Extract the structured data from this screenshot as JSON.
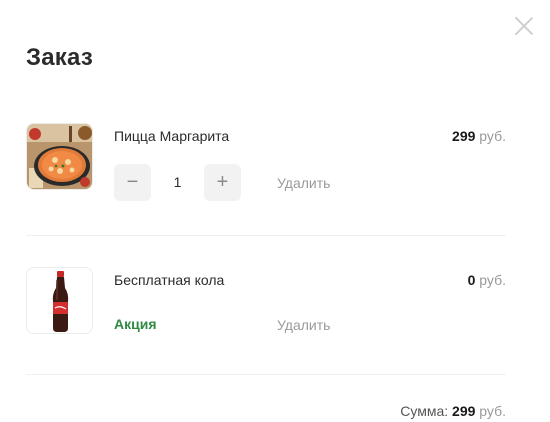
{
  "modal": {
    "title": "Заказ",
    "close_icon": "close-icon"
  },
  "items": [
    {
      "name": "Пицца Маргарита",
      "price_value": "299",
      "price_unit": "руб.",
      "quantity": "1",
      "minus_label": "−",
      "plus_label": "+",
      "delete_label": "Удалить",
      "image": "pizza-image"
    },
    {
      "name": "Бесплатная кола",
      "price_value": "0",
      "price_unit": "руб.",
      "promo_label": "Акция",
      "delete_label": "Удалить",
      "image": "cola-bottle-image"
    }
  ],
  "summary": {
    "label": "Сумма:",
    "value": "299",
    "unit": "руб."
  },
  "colors": {
    "promo": "#2f8a43",
    "muted": "#9a9a9a",
    "button_bg": "#f2f2f2"
  }
}
